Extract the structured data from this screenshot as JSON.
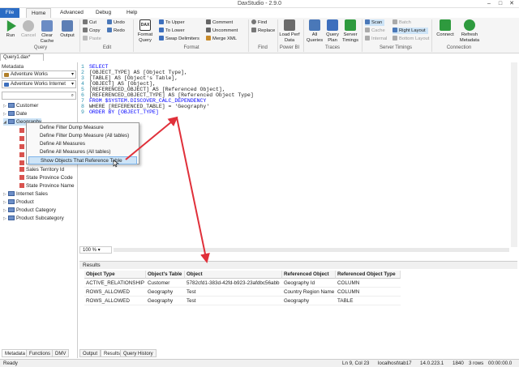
{
  "window": {
    "title": "DaxStudio - 2.9.0"
  },
  "tabs": [
    "File",
    "Home",
    "Advanced",
    "Debug",
    "Help"
  ],
  "ribbon": {
    "run": "Run",
    "cancel": "Cancel",
    "clear_cache": "Clear Cache",
    "output": "Output",
    "group_query": "Query",
    "cut": "Cut",
    "copy": "Copy",
    "paste": "Paste",
    "undo": "Undo",
    "redo": "Redo",
    "group_edit": "Edit",
    "format_query": "Format Query",
    "to_upper": "To Upper",
    "to_lower": "To Lower",
    "swap_delims": "Swap Delimiters",
    "comment": "Comment",
    "uncomment": "Uncomment",
    "merge_xml": "Merge XML",
    "group_format": "Format",
    "find": "Find",
    "replace": "Replace",
    "group_find": "Find",
    "load_perf": "Load Perf Data",
    "group_powerbi": "Power BI",
    "all_queries": "All Queries",
    "query_plan": "Query Plan",
    "server_timings": "Server Timings",
    "group_traces": "Traces",
    "scan": "Scan",
    "cache": "Cache",
    "internal": "Internal",
    "batch": "Batch",
    "right_layout": "Right Layout",
    "bottom_layout": "Bottom Layout",
    "group_server": "Server Timings",
    "connect": "Connect",
    "refresh_metadata": "Refresh Metadata",
    "group_connection": "Connection"
  },
  "document_tab": "Query1.dax*",
  "metadata": {
    "heading": "Metadata",
    "database": "Adventure Works",
    "model": "Adventure Works Internet",
    "tree": [
      {
        "label": "Customer",
        "kind": "table",
        "expanded": false
      },
      {
        "label": "Date",
        "kind": "table",
        "expanded": false
      },
      {
        "label": "Geography",
        "kind": "table",
        "expanded": true
      },
      {
        "label": "Sales Territory Id",
        "kind": "column"
      },
      {
        "label": "State Province Code",
        "kind": "column"
      },
      {
        "label": "State Province Name",
        "kind": "column"
      },
      {
        "label": "Internet Sales",
        "kind": "table",
        "expanded": false
      },
      {
        "label": "Product",
        "kind": "table",
        "expanded": false
      },
      {
        "label": "Product Category",
        "kind": "table",
        "expanded": false
      },
      {
        "label": "Product Subcategory",
        "kind": "table",
        "expanded": false
      }
    ],
    "bottom_tabs": [
      "Metadata",
      "Functions",
      "DMV"
    ]
  },
  "context_menu": [
    "Define Filter Dump Measure",
    "Define Filter Dump Measure (All tables)",
    "Define All Measures",
    "Define All Measures (All tables)",
    "Show Objects That Reference Table"
  ],
  "editor": {
    "lines": [
      {
        "n": "1",
        "text": "SELECT"
      },
      {
        "n": "2",
        "text": "[OBJECT_TYPE] AS [Object Type],"
      },
      {
        "n": "3",
        "text": "[TABLE] AS [Object's Table],"
      },
      {
        "n": "4",
        "text": "[OBJECT] AS [Object],"
      },
      {
        "n": "5",
        "text": "[REFERENCED_OBJECT] AS [Referenced Object],"
      },
      {
        "n": "6",
        "text": "[REFERENCED_OBJECT_TYPE] AS [Referenced Object Type]"
      },
      {
        "n": "7",
        "text": "FROM $SYSTEM.DISCOVER_CALC_DEPENDENCY"
      },
      {
        "n": "8",
        "text": "WHERE [REFERENCED_TABLE] = 'Geography'"
      },
      {
        "n": "9",
        "text": "ORDER BY [OBJECT_TYPE]"
      }
    ],
    "zoom": "100 %"
  },
  "results": {
    "heading": "Results",
    "columns": [
      "Object Type",
      "Object's Table",
      "Object",
      "Referenced Object",
      "Referenced Object Type"
    ],
    "rows": [
      [
        "ACTIVE_RELATIONSHIP",
        "Customer",
        "5782cfd1-383d-42fd-b923-23afdbc56abb",
        "Geography Id",
        "COLUMN"
      ],
      [
        "ROWS_ALLOWED",
        "Geography",
        "Test",
        "Country Region Name",
        "COLUMN"
      ],
      [
        "ROWS_ALLOWED",
        "Geography",
        "Test",
        "Geography",
        "TABLE"
      ]
    ],
    "bottom_tabs": [
      "Output",
      "Results",
      "Query History"
    ]
  },
  "status": {
    "ready": "Ready",
    "position": "Ln 9, Col 23",
    "server": "localhost\\tab17",
    "version": "14.0.223.1",
    "spid": "1840",
    "rows": "3 rows",
    "time": "00:00:00.0"
  },
  "colors": {
    "file_tab": "#2b6cc4",
    "accent_red": "#e0303a",
    "keyword": "#0000ff"
  }
}
